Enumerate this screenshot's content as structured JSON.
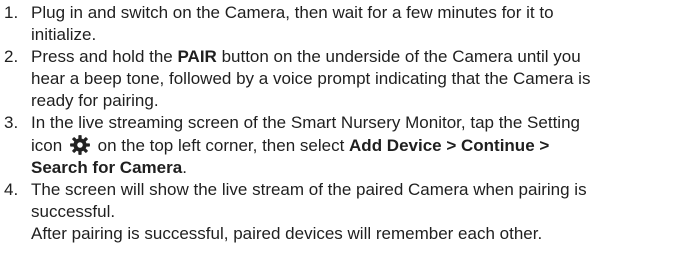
{
  "steps": [
    {
      "number": "1.",
      "lines": [
        "Plug in and switch on the Camera, then wait for a few minutes for it to",
        "initialize."
      ]
    },
    {
      "number": "2.",
      "line1_pre": "Press and hold the ",
      "line1_bold": "PAIR",
      "line1_post": " button on the underside of the Camera until you",
      "line2": "hear a beep tone, followed by a voice prompt indicating that the Camera is",
      "line3": "ready for pairing."
    },
    {
      "number": "3.",
      "line1": "In the live streaming screen of the Smart Nursery Monitor, tap the Setting",
      "line2_pre": "icon ",
      "icon": "gear-icon",
      "line2_mid": " on the top left corner, then select ",
      "line2_bold": "Add Device > Continue >",
      "line3_bold": "Search for Camera",
      "line3_post": "."
    },
    {
      "number": "4.",
      "lines": [
        "The screen will show the live stream of the paired Camera when pairing is",
        "successful.",
        "After pairing is successful, paired devices will remember each other."
      ]
    }
  ],
  "colors": {
    "text": "#1f1f1f",
    "icon": "#222222"
  }
}
